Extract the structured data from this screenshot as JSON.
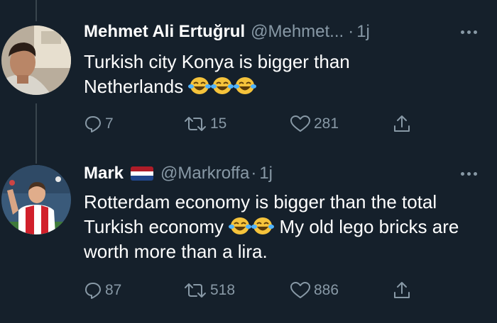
{
  "tweets": [
    {
      "author_name": "Mehmet Ali Ertuğrul",
      "handle": "@Mehmet...",
      "separator": "·",
      "time": "1j",
      "text": "Turkish city Konya is bigger than Netherlands",
      "replies": "7",
      "retweets": "15",
      "likes": "281",
      "avatar_icon": "profile-photo-man",
      "emoji_icon": "tears-of-joy-emoji"
    },
    {
      "author_name": "Mark",
      "handle": "@Markroffa",
      "separator": "·",
      "time": "1j",
      "text_part1": "Rotterdam economy is bigger than the total Turkish economy",
      "text_part2": "My old lego bricks are worth more than a lira.",
      "replies": "87",
      "retweets": "518",
      "likes": "886",
      "avatar_icon": "profile-photo-football-player",
      "flag_icon": "netherlands-flag",
      "emoji_icon": "tears-of-joy-emoji"
    }
  ],
  "colors": {
    "background": "#15202b",
    "text": "#ffffff",
    "secondary": "#8899a6",
    "thread_line": "#38444d",
    "flag_red": "#ae1c28",
    "flag_white": "#ffffff",
    "flag_blue": "#21468b"
  }
}
